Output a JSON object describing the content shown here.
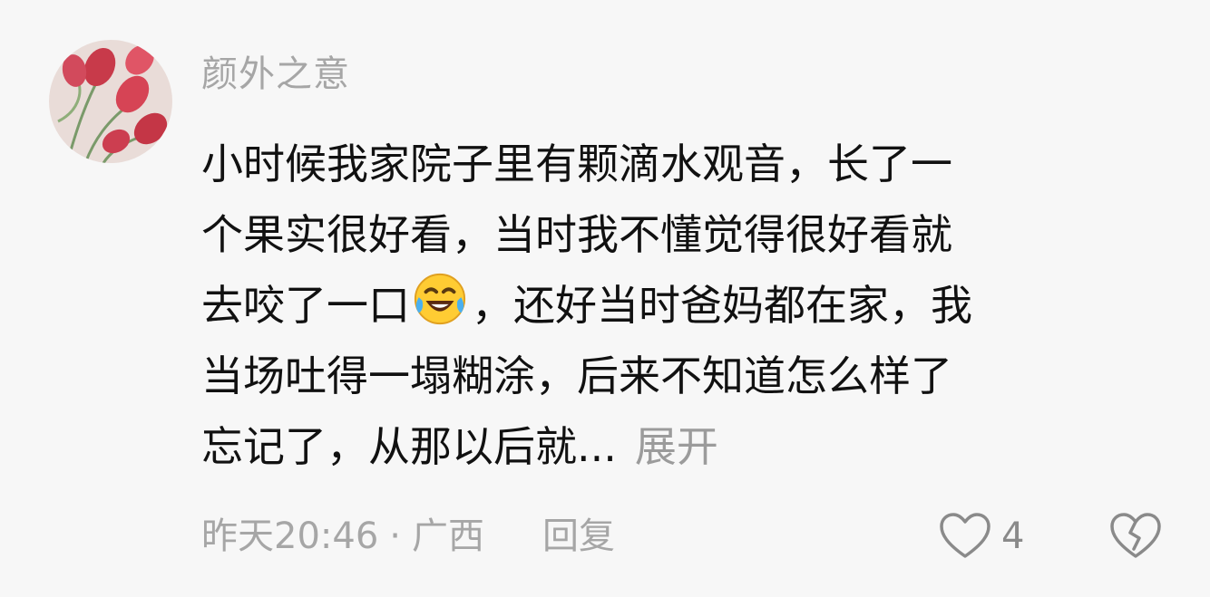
{
  "comment": {
    "username": "颜外之意",
    "content_lines": [
      "小时候我家院子里有颗滴水观音，长了一",
      "个果实很好看，当时我不懂觉得很好看就",
      "去咬了一口",
      "，还好当时爸妈都在家，我",
      "当场吐得一塌糊涂，后来不知道怎么样了",
      "忘记了，从那以后就..."
    ],
    "expand_label": "展开",
    "timestamp": "昨天20:46",
    "separator": "·",
    "location": "广西",
    "reply_label": "回复",
    "like_count": "4",
    "icons": {
      "avatar": "tulip-avatar",
      "emoji": "laughing-crying-emoji",
      "like": "heart-outline-icon",
      "dislike": "broken-heart-icon"
    },
    "colors": {
      "background": "#f7f7f7",
      "text": "#111111",
      "muted": "#a6a6a6"
    }
  }
}
